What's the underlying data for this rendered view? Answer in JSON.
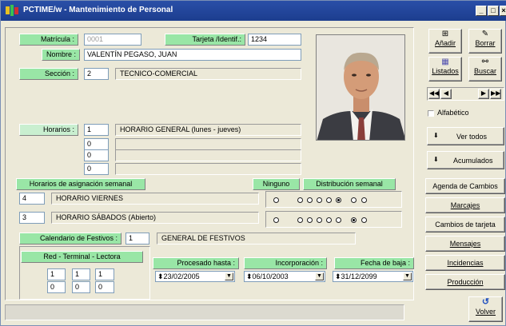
{
  "window": {
    "title": "PCTIME/w - Mantenimiento de Personal"
  },
  "fields": {
    "matricula_label": "Matrícula :",
    "matricula": "0001",
    "tarjeta_label": "Tarjeta /Identif.:",
    "tarjeta": "1234",
    "nombre_label": "Nombre :",
    "nombre": "VALENTÍN PEGASO, JUAN",
    "seccion_label": "Sección :",
    "seccion_code": "2",
    "seccion_name": "TECNICO-COMERCIAL",
    "horarios_label": "Horarios :"
  },
  "horarios": [
    {
      "code": "1",
      "name": "HORARIO  GENERAL (lunes - jueves)"
    },
    {
      "code": "0",
      "name": ""
    },
    {
      "code": "0",
      "name": ""
    },
    {
      "code": "0",
      "name": ""
    },
    {
      "code": "0",
      "name": ""
    }
  ],
  "semanal": {
    "label": "Horarios de asignación semanal",
    "ninguno": "Ninguno",
    "distribucion": "Distribución semanal",
    "rows": [
      {
        "code": "4",
        "name": "HORARIO  VIERNES"
      },
      {
        "code": "3",
        "name": "HORARIO SÁBADOS (Abierto)"
      }
    ]
  },
  "festivos": {
    "label": "Calendario de Festivos :",
    "code": "1",
    "name": "GENERAL DE FESTIVOS"
  },
  "red": {
    "label": "Red - Terminal - Lectora",
    "row1": [
      "1",
      "1",
      "1"
    ],
    "row2": [
      "0",
      "0",
      "0"
    ]
  },
  "dates": {
    "procesado_label": "Procesado hasta :",
    "procesado": "23/02/2005",
    "incorporacion_label": "Incorporación :",
    "incorporacion": "06/10/2003",
    "baja_label": "Fecha de baja :",
    "baja": "31/12/2099"
  },
  "toolbar": {
    "anadir": "Añadir",
    "borrar": "Borrar",
    "listados": "Listados",
    "buscar": "Buscar"
  },
  "right_panel": {
    "alfabetico": "Alfabético",
    "ver_todos": "Ver todos",
    "acumulados": "Acumulados",
    "agenda": "Agenda de Cambios",
    "marcajes": "Marcajes",
    "cambios_tarjeta": "Cambios de tarjeta",
    "mensajes": "Mensajes",
    "incidencias": "Incidencias",
    "produccion": "Producción",
    "volver": "Volver"
  },
  "colors": {
    "title_bar": "#1c3d8e",
    "label_green": "#99e6a6",
    "background": "#ece9d8"
  }
}
